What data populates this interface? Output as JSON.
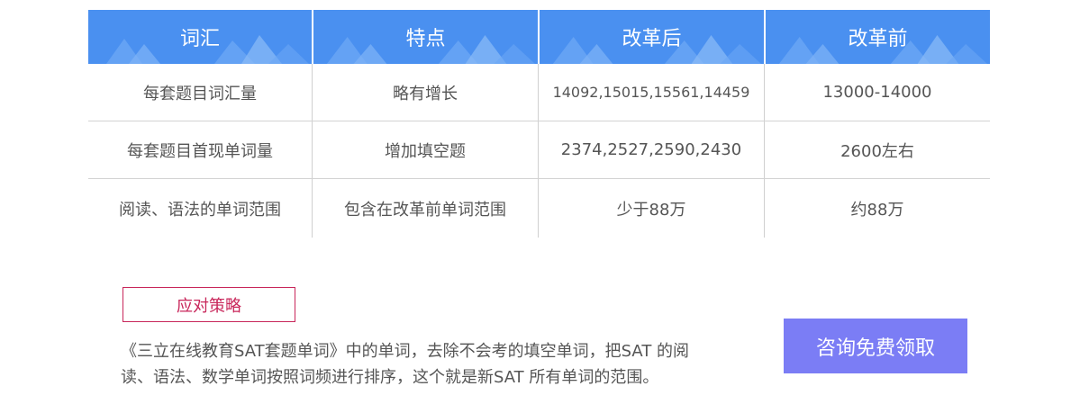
{
  "table": {
    "headers": [
      "词汇",
      "特点",
      "改革后",
      "改革前"
    ],
    "rows": [
      [
        "每套题目词汇量",
        "略有增长",
        "14092,15015,15561,14459",
        "13000-14000"
      ],
      [
        "每套题目首现单词量",
        "增加填空题",
        "2374,2527,2590,2430",
        "2600左右"
      ],
      [
        "阅读、语法的单词范围",
        "包含在改革前单词范围",
        "少于88万",
        "约88万"
      ]
    ]
  },
  "strategy": {
    "tag": "应对策略",
    "description_line1": "《三立在线教育SAT套题单词》中的单词，去除不会考的填空单词，把SAT 的阅",
    "description_line2": "读、语法、数学单词按照词频进行排序，这个就是新SAT 所有单词的范围。"
  },
  "cta": {
    "label": "咨询免费领取"
  },
  "colors": {
    "header_bg": "#4a90f0",
    "tag_accent": "#c8265a",
    "cta_bg": "#7b7df5"
  }
}
